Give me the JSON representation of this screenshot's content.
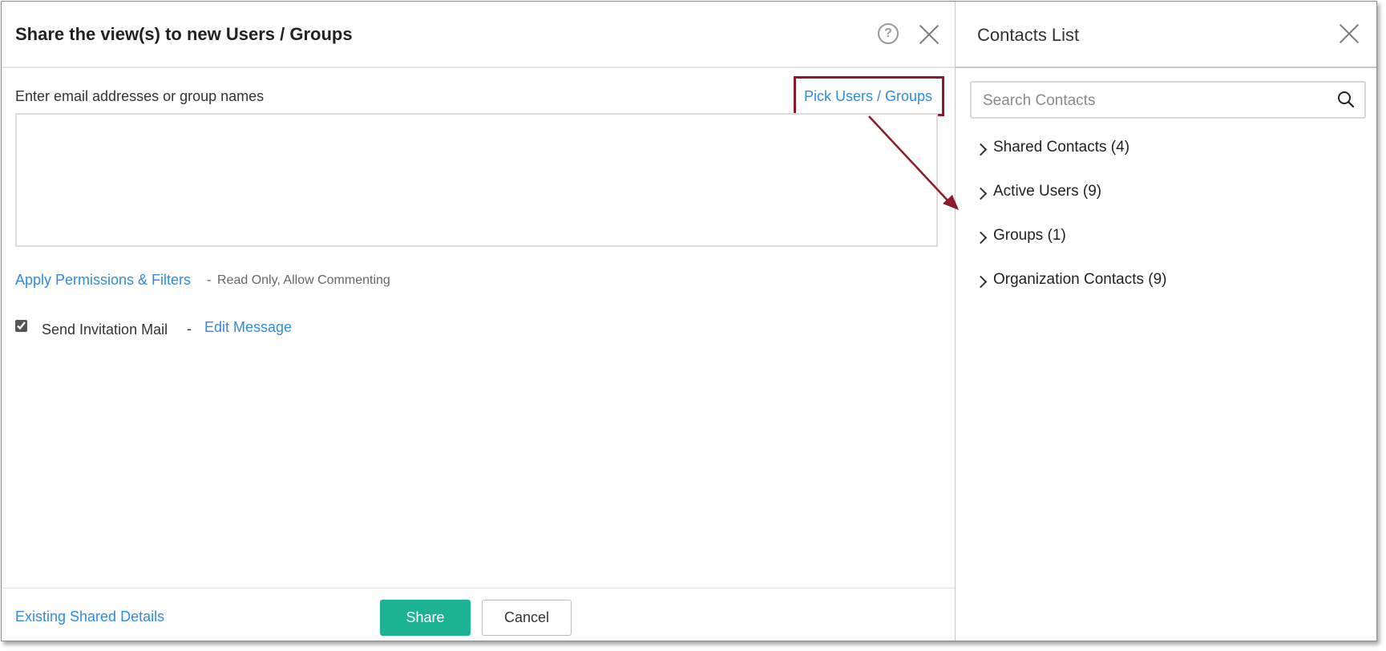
{
  "dialog": {
    "title": "Share the view(s) to new Users / Groups",
    "help_icon": "help-icon",
    "close_icon": "close-icon",
    "email_label": "Enter email addresses or group names",
    "email_value": "",
    "pick_link": "Pick Users / Groups",
    "permissions_link": "Apply Permissions & Filters",
    "permissions_separator": "-",
    "permissions_value": "Read Only, Allow Commenting",
    "invite_checked": true,
    "invite_label": "Send Invitation Mail",
    "invite_separator": "-",
    "edit_message_link": "Edit Message",
    "existing_link": "Existing Shared Details",
    "share_label": "Share",
    "cancel_label": "Cancel"
  },
  "contacts": {
    "title": "Contacts List",
    "close_icon": "close-icon",
    "search_placeholder": "Search Contacts",
    "search_icon": "search-icon",
    "groups": [
      {
        "label": "Shared Contacts (4)"
      },
      {
        "label": "Active Users (9)"
      },
      {
        "label": "Groups (1)"
      },
      {
        "label": "Organization Contacts (9)"
      }
    ]
  },
  "colors": {
    "link": "#2f8be0",
    "primary_button": "#1bb394",
    "annotation": "#8b1a2b"
  }
}
